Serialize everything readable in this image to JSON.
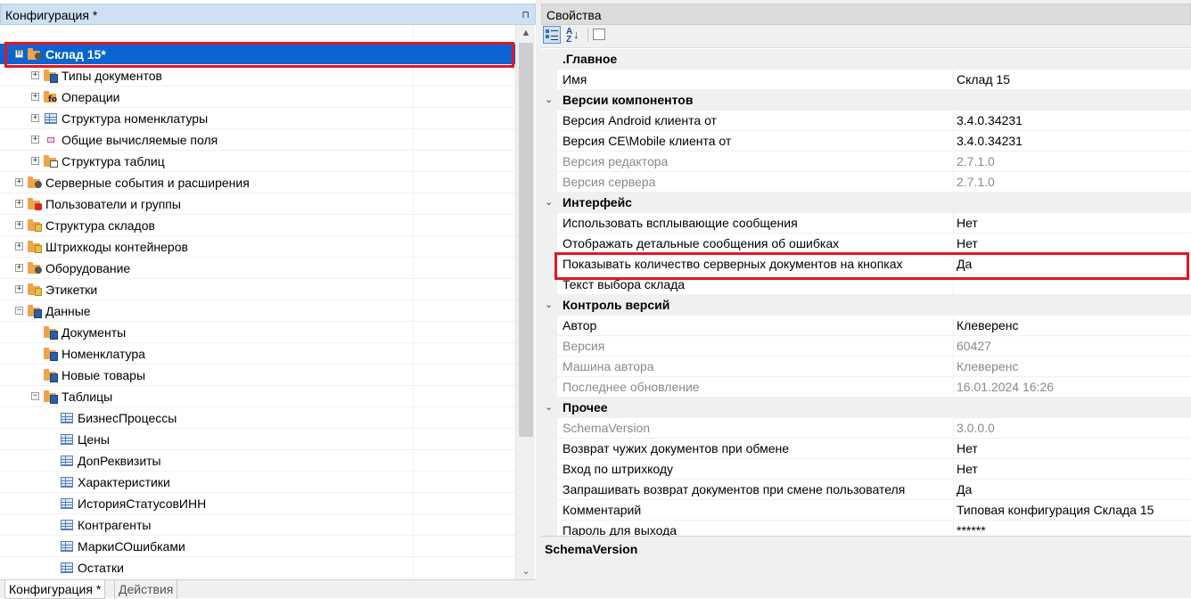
{
  "left_panel": {
    "title": "Конфигурация *",
    "pin_glyph": "⊓",
    "tree": [
      {
        "label": "Склад 15*",
        "level": 0,
        "expander": "⊟",
        "icon": "warehouse-folder-icon",
        "selected": true
      },
      {
        "label": "Типы документов",
        "level": 1,
        "expander": "+",
        "icon": "document-types-folder-icon"
      },
      {
        "label": "Операции",
        "level": 1,
        "expander": "+",
        "icon": "operations-folder-icon"
      },
      {
        "label": "Структура номенклатуры",
        "level": 1,
        "expander": "+",
        "icon": "table-icon"
      },
      {
        "label": "Общие вычисляемые поля",
        "level": 1,
        "expander": "+",
        "icon": "calculated-fields-icon"
      },
      {
        "label": "Структура таблиц",
        "level": 1,
        "expander": "+",
        "icon": "tables-folder-icon"
      },
      {
        "label": "Серверные события и расширения",
        "level": 0,
        "expander": "+",
        "icon": "server-events-folder-icon"
      },
      {
        "label": "Пользователи и группы",
        "level": 0,
        "expander": "+",
        "icon": "users-folder-icon"
      },
      {
        "label": "Структура складов",
        "level": 0,
        "expander": "+",
        "icon": "warehouse-structure-folder-icon"
      },
      {
        "label": "Штрихкоды контейнеров",
        "level": 0,
        "expander": "+",
        "icon": "container-barcodes-folder-icon"
      },
      {
        "label": "Оборудование",
        "level": 0,
        "expander": "+",
        "icon": "equipment-folder-icon"
      },
      {
        "label": "Этикетки",
        "level": 0,
        "expander": "+",
        "icon": "labels-folder-icon"
      },
      {
        "label": "Данные",
        "level": 0,
        "expander": "−",
        "icon": "data-folder-icon"
      },
      {
        "label": "Документы",
        "level": 1,
        "expander": "",
        "icon": "documents-folder-icon"
      },
      {
        "label": "Номенклатура",
        "level": 1,
        "expander": "",
        "icon": "nomenclature-folder-icon"
      },
      {
        "label": "Новые товары",
        "level": 1,
        "expander": "",
        "icon": "new-goods-folder-icon"
      },
      {
        "label": "Таблицы",
        "level": 1,
        "expander": "−",
        "icon": "tables-data-folder-icon"
      },
      {
        "label": "БизнесПроцессы",
        "level": 2,
        "expander": "",
        "icon": "table-icon"
      },
      {
        "label": "Цены",
        "level": 2,
        "expander": "",
        "icon": "table-icon"
      },
      {
        "label": "ДопРеквизиты",
        "level": 2,
        "expander": "",
        "icon": "table-icon"
      },
      {
        "label": "Характеристики",
        "level": 2,
        "expander": "",
        "icon": "table-icon"
      },
      {
        "label": "ИсторияСтатусовИНН",
        "level": 2,
        "expander": "",
        "icon": "table-icon"
      },
      {
        "label": "Контрагенты",
        "level": 2,
        "expander": "",
        "icon": "table-icon"
      },
      {
        "label": "МаркиСОшибками",
        "level": 2,
        "expander": "",
        "icon": "table-icon"
      },
      {
        "label": "Остатки",
        "level": 2,
        "expander": "",
        "icon": "table-icon"
      }
    ],
    "bottom_tabs": [
      "Конфигурация *",
      "Действия"
    ],
    "scroll_arrows": {
      "up": "▲",
      "down": "⌄"
    }
  },
  "right_panel": {
    "title": "Свойства",
    "toolbar": {
      "az_label": "A\nZ↓"
    },
    "categories": [
      {
        "name": ".Главное",
        "caret": "",
        "rows": [
          {
            "name": "Имя",
            "value": "Склад 15",
            "dim": false
          }
        ]
      },
      {
        "name": "Версии компонентов",
        "caret": "⌄",
        "rows": [
          {
            "name": "Версия Android клиента от",
            "value": "3.4.0.34231",
            "dim": false
          },
          {
            "name": "Версия CE\\Mobile клиента от",
            "value": "3.4.0.34231",
            "dim": false
          },
          {
            "name": "Версия редактора",
            "value": "2.7.1.0",
            "dim": true
          },
          {
            "name": "Версия сервера",
            "value": "2.7.1.0",
            "dim": true
          }
        ]
      },
      {
        "name": "Интерфейс",
        "caret": "⌄",
        "rows": [
          {
            "name": "Использовать всплывающие сообщения",
            "value": "Нет",
            "dim": false
          },
          {
            "name": "Отображать детальные сообщения об ошибках",
            "value": "Нет",
            "dim": false
          },
          {
            "name": "Показывать количество серверных документов на кнопках",
            "value": "Да",
            "dim": false
          },
          {
            "name": "Текст выбора склада",
            "value": "",
            "dim": false
          }
        ]
      },
      {
        "name": "Контроль версий",
        "caret": "⌄",
        "rows": [
          {
            "name": "Автор",
            "value": "Клеверенс",
            "dim": false
          },
          {
            "name": "Версия",
            "value": "60427",
            "dim": true
          },
          {
            "name": "Машина автора",
            "value": "Клеверенс",
            "dim": true
          },
          {
            "name": "Последнее обновление",
            "value": "16.01.2024 16:26",
            "dim": true
          }
        ]
      },
      {
        "name": "Прочее",
        "caret": "⌄",
        "rows": [
          {
            "name": "SchemaVersion",
            "value": "3.0.0.0",
            "dim": true
          },
          {
            "name": "Возврат чужих документов при обмене",
            "value": "Нет",
            "dim": false
          },
          {
            "name": "Вход по штрихкоду",
            "value": "Нет",
            "dim": false
          },
          {
            "name": "Запрашивать возврат документов при смене пользователя",
            "value": "Да",
            "dim": false
          },
          {
            "name": "Комментарий",
            "value": "Типовая конфигурация Склада 15",
            "dim": false
          },
          {
            "name": "Пароль для выхода",
            "value": "******",
            "dim": false
          }
        ]
      }
    ],
    "description": {
      "title": "SchemaVersion"
    }
  },
  "colors": {
    "selection": "#0a64d2",
    "highlight_outline": "#e3161f",
    "header": "#cde0f4"
  }
}
